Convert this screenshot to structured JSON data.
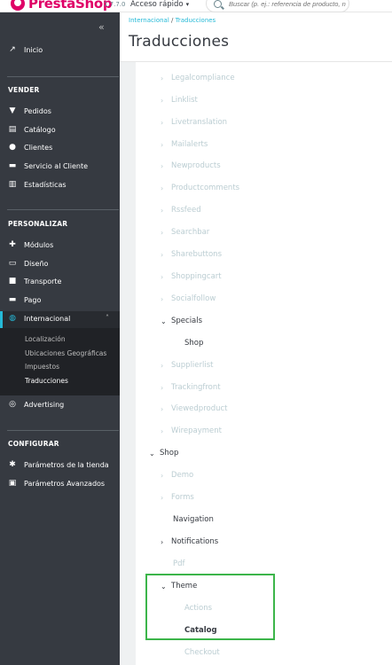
{
  "header": {
    "brand": "PrestaShop",
    "version": "1.7.7.0",
    "quick_access": "Acceso rápido",
    "search_placeholder": "Buscar (p. ej.: referencia de producto, n"
  },
  "sidebar": {
    "collapse_glyph": "«",
    "inicio": "Inicio",
    "sections": {
      "vender": "VENDER",
      "personalizar": "PERSONALIZAR",
      "configurar": "CONFIGURAR"
    },
    "vender_items": [
      "Pedidos",
      "Catálogo",
      "Clientes",
      "Servicio al Cliente",
      "Estadísticas"
    ],
    "personalizar_items": [
      "Módulos",
      "Diseño",
      "Transporte",
      "Pago",
      "Internacional"
    ],
    "internacional_sub": [
      "Localización",
      "Ubicaciones Geográficas",
      "Impuestos",
      "Traducciones"
    ],
    "advertising": "Advertising",
    "configurar_items": [
      "Parámetros de la tienda",
      "Parámetros Avanzados"
    ]
  },
  "breadcrumb": {
    "parent": "Internacional",
    "current": "Traducciones"
  },
  "page_title": "Traducciones",
  "tree": {
    "modules": [
      "Legalcompliance",
      "Linklist",
      "Livetranslation",
      "Mailalerts",
      "Newproducts",
      "Productcomments",
      "Rssfeed",
      "Searchbar",
      "Sharebuttons",
      "Shoppingcart",
      "Socialfollow",
      "Specials",
      "Supplierlist",
      "Trackingfront",
      "Viewedproduct",
      "Wirepayment"
    ],
    "specials_child": "Shop",
    "shop": "Shop",
    "shop_children": [
      "Demo",
      "Forms",
      "Navigation",
      "Notifications",
      "Pdf",
      "Theme"
    ],
    "theme_children": [
      "Actions",
      "Catalog",
      "Checkout"
    ]
  },
  "colors": {
    "accent": "#25b9d7",
    "brand": "#df0067",
    "sidebar_bg": "#363a41",
    "highlight": "#3cb54a",
    "muted_text": "#bbcdd2"
  }
}
